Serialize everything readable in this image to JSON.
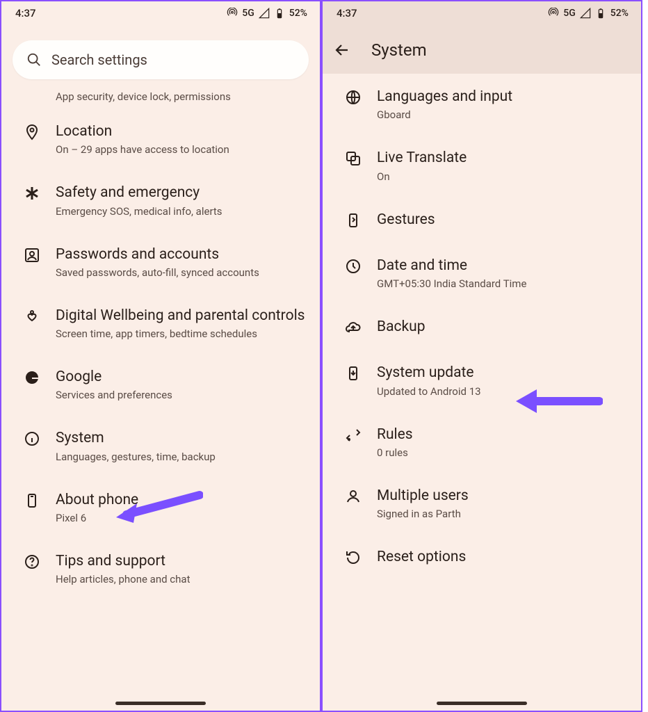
{
  "status": {
    "time": "4:37",
    "network": "5G",
    "battery": "52%"
  },
  "left": {
    "search_placeholder": "Search settings",
    "top_sub": "App security, device lock, permissions",
    "items": [
      {
        "icon": "location",
        "title": "Location",
        "sub": "On – 29 apps have access to location"
      },
      {
        "icon": "asterisk",
        "title": "Safety and emergency",
        "sub": "Emergency SOS, medical info, alerts"
      },
      {
        "icon": "person-box",
        "title": "Passwords and accounts",
        "sub": "Saved passwords, auto-fill, synced accounts"
      },
      {
        "icon": "wellbeing",
        "title": "Digital Wellbeing and parental controls",
        "sub": "Screen time, app timers, bedtime schedules"
      },
      {
        "icon": "google",
        "title": "Google",
        "sub": "Services and preferences"
      },
      {
        "icon": "info",
        "title": "System",
        "sub": "Languages, gestures, time, backup"
      },
      {
        "icon": "phone-box",
        "title": "About phone",
        "sub": "Pixel 6"
      },
      {
        "icon": "help",
        "title": "Tips and support",
        "sub": "Help articles, phone and chat"
      }
    ]
  },
  "right": {
    "title": "System",
    "items": [
      {
        "icon": "globe",
        "title": "Languages and input",
        "sub": "Gboard"
      },
      {
        "icon": "translate",
        "title": "Live Translate",
        "sub": "On"
      },
      {
        "icon": "gestures",
        "title": "Gestures",
        "sub": ""
      },
      {
        "icon": "clock",
        "title": "Date and time",
        "sub": "GMT+05:30 India Standard Time"
      },
      {
        "icon": "cloud",
        "title": "Backup",
        "sub": ""
      },
      {
        "icon": "phone-update",
        "title": "System update",
        "sub": "Updated to Android 13"
      },
      {
        "icon": "rules",
        "title": "Rules",
        "sub": "0 rules"
      },
      {
        "icon": "person",
        "title": "Multiple users",
        "sub": "Signed in as Parth"
      },
      {
        "icon": "reset",
        "title": "Reset options",
        "sub": ""
      }
    ]
  }
}
